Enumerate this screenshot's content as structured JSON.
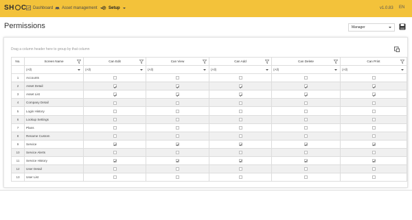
{
  "app": {
    "logo": [
      "SH",
      "C"
    ],
    "version": "v1.0.83",
    "lang": "EN"
  },
  "nav": [
    {
      "label": "Dashboard",
      "icon": "chart-icon"
    },
    {
      "label": "Asset management",
      "icon": "car-icon"
    },
    {
      "label": "Setup",
      "icon": "gear-icon",
      "active": true
    }
  ],
  "page": {
    "title": "Permissions",
    "role": "Manager"
  },
  "grid": {
    "group_hint": "Drag a column header here to group by that column",
    "columns": [
      "No.",
      "Screen Name",
      "Can Edit",
      "Can View",
      "Can Add",
      "Can Delete",
      "Can Print"
    ],
    "filter_value": "(All)",
    "rows": [
      {
        "no": "1",
        "name": "Accounts",
        "edit": false,
        "view": false,
        "add": false,
        "del": false,
        "print": false
      },
      {
        "no": "2",
        "name": "Asset Detail",
        "edit": true,
        "view": true,
        "add": true,
        "del": true,
        "print": true
      },
      {
        "no": "3",
        "name": "Asset List",
        "edit": true,
        "view": true,
        "add": true,
        "del": true,
        "print": true
      },
      {
        "no": "4",
        "name": "Company Detail",
        "edit": false,
        "view": false,
        "add": false,
        "del": false,
        "print": false
      },
      {
        "no": "5",
        "name": "Login History",
        "edit": false,
        "view": false,
        "add": false,
        "del": false,
        "print": false
      },
      {
        "no": "6",
        "name": "Lookup Settings",
        "edit": false,
        "view": false,
        "add": false,
        "del": false,
        "print": false
      },
      {
        "no": "7",
        "name": "Plans",
        "edit": false,
        "view": false,
        "add": false,
        "del": false,
        "print": false
      },
      {
        "no": "8",
        "name": "Rename Custom",
        "edit": false,
        "view": false,
        "add": false,
        "del": false,
        "print": false
      },
      {
        "no": "9",
        "name": "Service",
        "edit": true,
        "view": true,
        "add": true,
        "del": true,
        "print": true
      },
      {
        "no": "10",
        "name": "Service Alerts",
        "edit": false,
        "view": false,
        "add": false,
        "del": false,
        "print": false
      },
      {
        "no": "11",
        "name": "Service History",
        "edit": true,
        "view": true,
        "add": true,
        "del": true,
        "print": true
      },
      {
        "no": "12",
        "name": "User Detail",
        "edit": false,
        "view": false,
        "add": false,
        "del": false,
        "print": false
      },
      {
        "no": "13",
        "name": "User List",
        "edit": false,
        "view": false,
        "add": false,
        "del": false,
        "print": false
      }
    ]
  },
  "colors": {
    "topbar": "#f3c23a",
    "row_alt": "#f0f0f0"
  }
}
